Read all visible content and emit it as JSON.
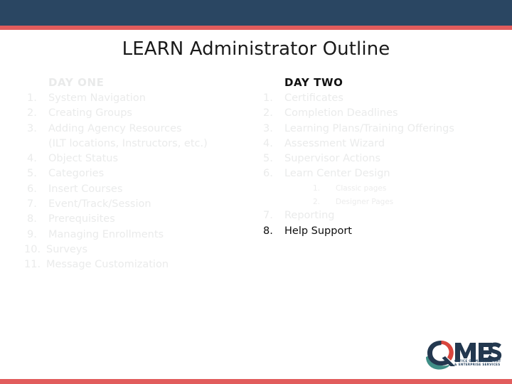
{
  "theme": {
    "band_navy": "#2a4662",
    "rule_red": "#e15c5c",
    "faded_text": "#eaebeb",
    "active_text": "#0e0e0e",
    "title_text": "#1a1a1a"
  },
  "title": "LEARN Administrator Outline",
  "columns": [
    {
      "heading": "DAY ONE",
      "heading_state": "faded",
      "items": [
        {
          "num": "1.",
          "text": "System Navigation",
          "state": "faded"
        },
        {
          "num": "2.",
          "text": "Creating Groups",
          "state": "faded"
        },
        {
          "num": "3.",
          "text": "Adding Agency Resources",
          "continuation": "(ILT locations, Instructors, etc.)",
          "state": "faded"
        },
        {
          "num": "4.",
          "text": "Object Status",
          "state": "faded"
        },
        {
          "num": "5.",
          "text": "Categories",
          "state": "faded"
        },
        {
          "num": "6.",
          "text": "Insert Courses",
          "state": "faded"
        },
        {
          "num": "7.",
          "text": "Event/Track/Session",
          "state": "faded"
        },
        {
          "num": "8.",
          "text": "Prerequisites",
          "state": "faded"
        },
        {
          "num": "9.",
          "text": "Managing Enrollments",
          "state": "faded"
        },
        {
          "num": "10.",
          "text": "Surveys",
          "state": "faded"
        },
        {
          "num": "11.",
          "text": "Message Customization",
          "state": "faded"
        }
      ]
    },
    {
      "heading": "DAY TWO",
      "heading_state": "active",
      "items": [
        {
          "num": "1.",
          "text": "Certificates",
          "state": "faded"
        },
        {
          "num": "2.",
          "text": "Completion Deadlines",
          "state": "faded"
        },
        {
          "num": "3.",
          "text": "Learning Plans/Training Offerings",
          "state": "faded"
        },
        {
          "num": "4.",
          "text": "Assessment Wizard",
          "state": "faded"
        },
        {
          "num": "5.",
          "text": "Supervisor Actions",
          "state": "faded"
        },
        {
          "num": "6.",
          "text": "Learn Center Design",
          "state": "faded",
          "sub": [
            {
              "num": "1.",
              "text": "Classic pages",
              "state": "faded"
            },
            {
              "num": "2.",
              "text": "Designer Pages",
              "state": "faded"
            }
          ]
        },
        {
          "num": "7.",
          "text": "Reporting",
          "state": "faded"
        },
        {
          "num": "8.",
          "text": "Help Support",
          "state": "active"
        }
      ]
    }
  ],
  "logo": {
    "name": "omes-logo",
    "wordmark": "MES",
    "tagline_line1": "OFFICE OF MANAGEMENT",
    "tagline_line2": "& ENTERPRISE SERVICES",
    "color_navy": "#23384f",
    "color_red": "#d9453d",
    "color_teal": "#3f8f87"
  }
}
